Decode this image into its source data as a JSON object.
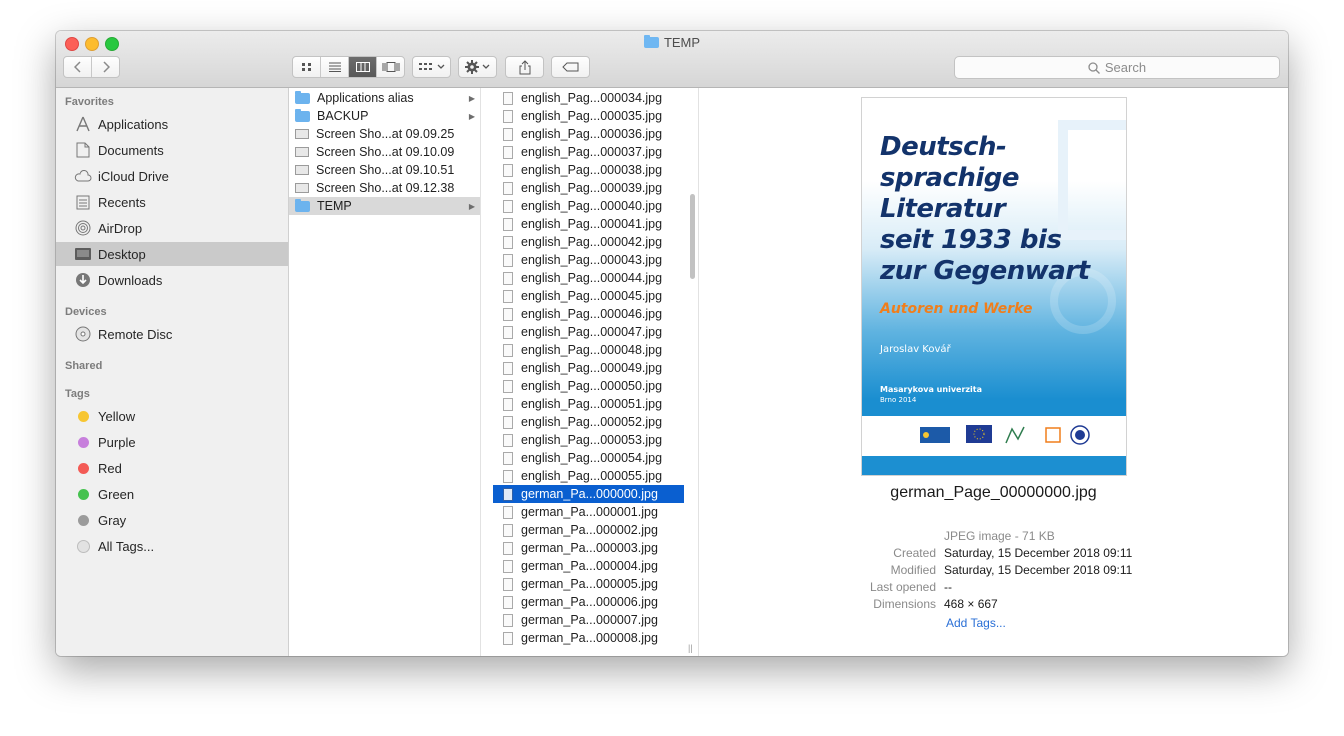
{
  "window": {
    "title": "TEMP"
  },
  "toolbar": {
    "back_icon": "chevron-left-icon",
    "forward_icon": "chevron-right-icon",
    "view_modes": [
      "icon-view-icon",
      "list-view-icon",
      "column-view-icon",
      "gallery-view-icon"
    ],
    "active_view": "column-view-icon",
    "search_placeholder": "Search"
  },
  "sidebar": {
    "favorites_header": "Favorites",
    "favorites": [
      {
        "label": "Applications",
        "icon": "applications-icon"
      },
      {
        "label": "Documents",
        "icon": "documents-icon"
      },
      {
        "label": "iCloud Drive",
        "icon": "cloud-icon"
      },
      {
        "label": "Recents",
        "icon": "recents-icon"
      },
      {
        "label": "AirDrop",
        "icon": "airdrop-icon"
      },
      {
        "label": "Desktop",
        "icon": "desktop-icon",
        "selected": true
      },
      {
        "label": "Downloads",
        "icon": "downloads-icon"
      }
    ],
    "devices_header": "Devices",
    "devices": [
      {
        "label": "Remote Disc",
        "icon": "disc-icon"
      }
    ],
    "shared_header": "Shared",
    "tags_header": "Tags",
    "tags": [
      {
        "label": "Yellow",
        "color": "#f7c632"
      },
      {
        "label": "Purple",
        "color": "#c77fdc"
      },
      {
        "label": "Red",
        "color": "#f35a55"
      },
      {
        "label": "Green",
        "color": "#46c24f"
      },
      {
        "label": "Gray",
        "color": "#9b9b9b"
      },
      {
        "label": "All Tags...",
        "color": "#e2e2e2"
      }
    ]
  },
  "column1": [
    {
      "label": "Applications alias",
      "type": "alias",
      "arrow": true
    },
    {
      "label": "BACKUP",
      "type": "folder",
      "arrow": true
    },
    {
      "label": "Screen Sho...at 09.09.25",
      "type": "screenshot"
    },
    {
      "label": "Screen Sho...at 09.10.09",
      "type": "screenshot"
    },
    {
      "label": "Screen Sho...at 09.10.51",
      "type": "screenshot"
    },
    {
      "label": "Screen Sho...at 09.12.38",
      "type": "screenshot"
    },
    {
      "label": "TEMP",
      "type": "folder",
      "arrow": true,
      "selected": true
    }
  ],
  "column2": [
    "english_Pag...000034.jpg",
    "english_Pag...000035.jpg",
    "english_Pag...000036.jpg",
    "english_Pag...000037.jpg",
    "english_Pag...000038.jpg",
    "english_Pag...000039.jpg",
    "english_Pag...000040.jpg",
    "english_Pag...000041.jpg",
    "english_Pag...000042.jpg",
    "english_Pag...000043.jpg",
    "english_Pag...000044.jpg",
    "english_Pag...000045.jpg",
    "english_Pag...000046.jpg",
    "english_Pag...000047.jpg",
    "english_Pag...000048.jpg",
    "english_Pag...000049.jpg",
    "english_Pag...000050.jpg",
    "english_Pag...000051.jpg",
    "english_Pag...000052.jpg",
    "english_Pag...000053.jpg",
    "english_Pag...000054.jpg",
    "english_Pag...000055.jpg",
    "german_Pa...000000.jpg",
    "german_Pa...000001.jpg",
    "german_Pa...000002.jpg",
    "german_Pa...000003.jpg",
    "german_Pa...000004.jpg",
    "german_Pa...000005.jpg",
    "german_Pa...000006.jpg",
    "german_Pa...000007.jpg",
    "german_Pa...000008.jpg"
  ],
  "column2_selected": "german_Pa...000000.jpg",
  "preview": {
    "cover": {
      "title_lines": [
        "Deutsch-",
        "sprachige",
        "Literatur",
        "seit 1933 bis",
        "zur Gegenwart"
      ],
      "subtitle": "Autoren und Werke",
      "author": "Jaroslav Kovář",
      "publisher": "Masarykova univerzita",
      "place_year": "Brno 2014"
    },
    "filename": "german_Page_00000000.jpg",
    "kind": "JPEG image - 71 KB",
    "created_label": "Created",
    "created": "Saturday, 15 December 2018 09:11",
    "modified_label": "Modified",
    "modified": "Saturday, 15 December 2018 09:11",
    "last_opened_label": "Last opened",
    "last_opened": "--",
    "dimensions_label": "Dimensions",
    "dimensions": "468 × 667",
    "add_tags": "Add Tags..."
  }
}
